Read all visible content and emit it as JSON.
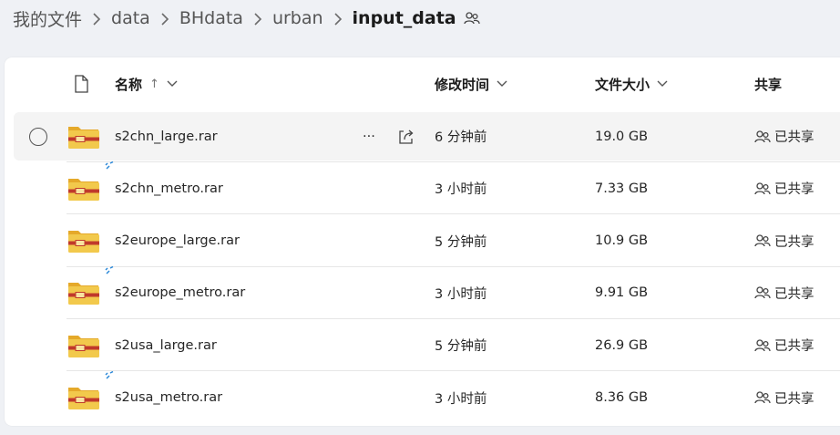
{
  "breadcrumb": {
    "items": [
      "我的文件",
      "data",
      "BHdata",
      "urban"
    ],
    "current": "input_data"
  },
  "header": {
    "name": "名称",
    "sort_arrow": "↑",
    "modified": "修改时间",
    "size": "文件大小",
    "sharing": "共享"
  },
  "files": [
    {
      "name": "s2chn_large.rar",
      "modified": "6 分钟前",
      "size": "19.0 GB",
      "sharing": "已共享",
      "selected": true,
      "syncing": false
    },
    {
      "name": "s2chn_metro.rar",
      "modified": "3 小时前",
      "size": "7.33 GB",
      "sharing": "已共享",
      "selected": false,
      "syncing": true
    },
    {
      "name": "s2europe_large.rar",
      "modified": "5 分钟前",
      "size": "10.9 GB",
      "sharing": "已共享",
      "selected": false,
      "syncing": false
    },
    {
      "name": "s2europe_metro.rar",
      "modified": "3 小时前",
      "size": "9.91 GB",
      "sharing": "已共享",
      "selected": false,
      "syncing": true
    },
    {
      "name": "s2usa_large.rar",
      "modified": "5 分钟前",
      "size": "26.9 GB",
      "sharing": "已共享",
      "selected": false,
      "syncing": false
    },
    {
      "name": "s2usa_metro.rar",
      "modified": "3 小时前",
      "size": "8.36 GB",
      "sharing": "已共享",
      "selected": false,
      "syncing": true
    }
  ],
  "row_actions": {
    "more_glyph": "···"
  },
  "colors": {
    "folder_body": "#f2c94c",
    "folder_tab": "#e5a92a",
    "archive_band": "#c0392b",
    "sync_accent": "#2b88d8"
  }
}
